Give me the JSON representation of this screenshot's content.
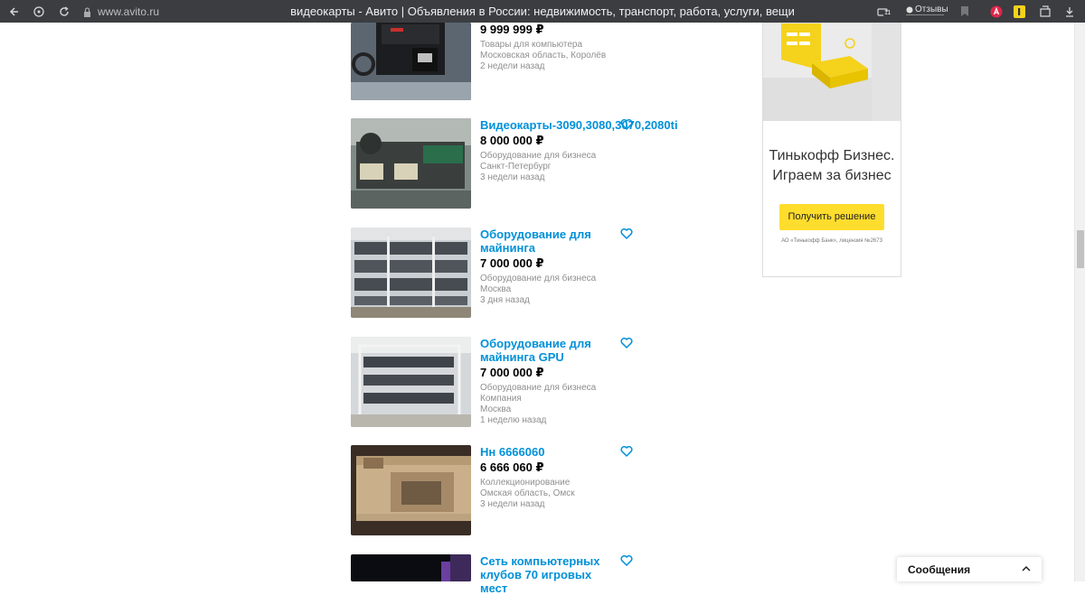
{
  "browser": {
    "url": "www.avito.ru",
    "title": "видеокарты - Авито | Объявления в России: недвижимость, транспорт, работа, услуги, вещи",
    "reviews_label": "Отзывы",
    "ext_badge": "11"
  },
  "listings": [
    {
      "title": "",
      "price": "9 999 999 ₽",
      "meta": [
        "Товары для компьютера",
        "Московская область, Королёв",
        "2 недели назад"
      ]
    },
    {
      "title": "Видеокарты-3090,3080,3070,2080ti",
      "price": "8 000 000 ₽",
      "meta": [
        "Оборудование для бизнеса",
        "Санкт-Петербург",
        "3 недели назад"
      ]
    },
    {
      "title": "Оборудование для майнинга",
      "price": "7 000 000 ₽",
      "meta": [
        "Оборудование для бизнеса",
        "Москва",
        "3 дня назад"
      ]
    },
    {
      "title": "Оборудование для майнинга GPU",
      "price": "7 000 000 ₽",
      "meta": [
        "Оборудование для бизнеса",
        "Компания",
        "Москва",
        "1 неделю назад"
      ]
    },
    {
      "title": "Нн 6666060",
      "price": "6 666 060 ₽",
      "meta": [
        "Коллекционирование",
        "Омская область, Омск",
        "3 недели назад"
      ]
    },
    {
      "title": "Сеть компьютерных клубов 70 игровых мест",
      "price": "",
      "meta": []
    }
  ],
  "ad": {
    "headline": "Тинькофф Бизнес. Играем за бизнес",
    "button_label": "Получить решение",
    "legal": "АО «Тинькофф Банк», лицензия №2673"
  },
  "messages": {
    "label": "Сообщения"
  },
  "colors": {
    "link": "#0091d9",
    "meta": "#8f8f8f",
    "ad_button": "#ffdd2d",
    "browser_bar": "#3b3d41"
  }
}
